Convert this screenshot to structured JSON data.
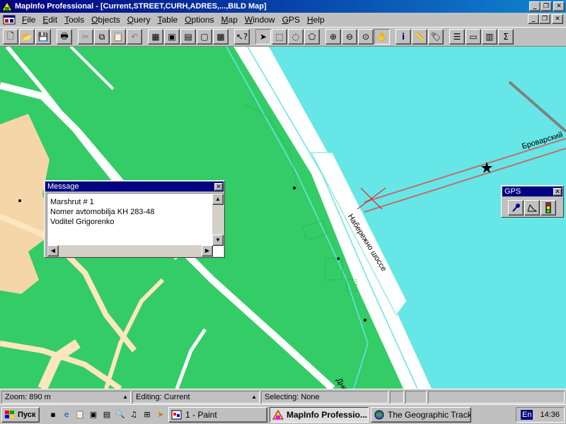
{
  "app": {
    "title": "MapInfo Professional - [Current,STREET,CURH,ADRES,...,BILD Map]"
  },
  "menu": [
    "File",
    "Edit",
    "Tools",
    "Objects",
    "Query",
    "Table",
    "Options",
    "Map",
    "Window",
    "GPS",
    "Help"
  ],
  "toolbar": {
    "tools": [
      "new",
      "open",
      "save",
      "print",
      "cut",
      "copy",
      "paste",
      "undo",
      "browser",
      "map",
      "graph",
      "layout",
      "redistrict",
      "help-pointer",
      "select",
      "marquee-select",
      "radius-select",
      "polygon-select",
      "zoom-in",
      "zoom-out",
      "change-view",
      "grabber",
      "info",
      "ruler",
      "label",
      "layer-control",
      "legend",
      "statistics",
      "sum"
    ]
  },
  "map": {
    "labels": [
      "Набережно шоссе",
      "Броварский",
      "Днеп"
    ],
    "colors": {
      "park": "#33cc66",
      "water": "#66e6e6",
      "road": "#ffffff",
      "buildings": "#f5d6a8"
    }
  },
  "message_window": {
    "title": "Message",
    "lines": [
      "Marshrut # 1",
      "Nomer avtomobilja KH 283-48",
      "Voditel Grigorenko"
    ]
  },
  "gps_palette": {
    "title": "GPS",
    "buttons": [
      "pin-icon",
      "polyline-icon",
      "traffic-light-icon"
    ]
  },
  "statusbar": {
    "zoom": "Zoom: 890 m",
    "editing": "Editing: Current",
    "selecting": "Selecting: None"
  },
  "taskbar": {
    "start_label": "Пуск",
    "tasks": [
      "1 - Paint",
      "MapInfo Professio...",
      "The Geographic Tracker"
    ],
    "active_task": 1,
    "language": "En",
    "time": "14:36"
  }
}
